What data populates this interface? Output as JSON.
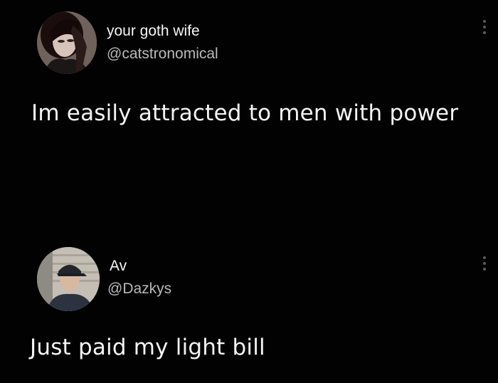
{
  "posts": [
    {
      "display_name": "your goth wife",
      "handle": "@catstronomical",
      "text": "Im easily attracted to men with power",
      "avatar_icon": "profile-photo",
      "menu_icon": "vertical-ellipsis-icon"
    },
    {
      "display_name": "Av",
      "handle": "@Dazkys",
      "text": "Just paid my light bill",
      "avatar_icon": "profile-photo",
      "menu_icon": "vertical-ellipsis-icon"
    }
  ],
  "colors": {
    "background": "#020202",
    "primary_text": "#f4f4f4",
    "secondary_text": "#b9b9b9",
    "menu_dots": "#5a5a5a"
  }
}
